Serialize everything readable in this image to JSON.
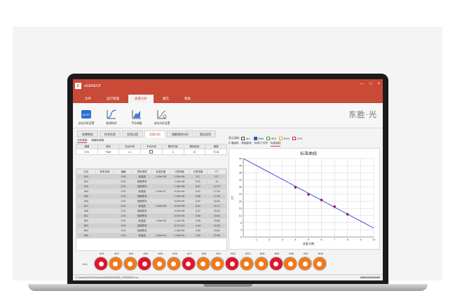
{
  "window": {
    "title": "eGENECP",
    "icon_letter": "E",
    "controls": [
      "—",
      "□",
      "×"
    ]
  },
  "menu": [
    "文件",
    "运行管理",
    "质量分析",
    "报告",
    "帮助"
  ],
  "menu_active_index": 2,
  "ribbon": {
    "buttons": [
      {
        "label": "自动分析设置",
        "icon": "auto-analysis-icon"
      },
      {
        "label": "曲线拟合",
        "icon": "curve-fit-icon"
      },
      {
        "label": "手动调整",
        "icon": "manual-adjust-icon"
      },
      {
        "label": "自动分析设置",
        "icon": "analysis-settings-icon"
      }
    ],
    "brand": "东胜·光"
  },
  "tabs": [
    "结果概览",
    "样本信息",
    "实验过程",
    "定量分析",
    "熔解曲线分析",
    "报告选项"
  ],
  "tabs_active_index": 3,
  "left": {
    "subtabs": [
      "分析参数",
      "阈值线参数"
    ],
    "param_headers": [
      "通道",
      "染料",
      "自动分析",
      "手动分析",
      "基线开始",
      "基线结束",
      "阈值"
    ],
    "param_row": [
      "CH1",
      "FAM",
      "1-1",
      "",
      "3",
      "10",
      "70.06"
    ],
    "sample_headers": [
      "孔位",
      "样本名称",
      "通道",
      "样本类型",
      "标准浓度",
      "计算浓度",
      "计算浓度",
      "CT"
    ],
    "samples": [
      [
        "A01",
        "",
        "CH1",
        "标准品",
        "1.00e+08",
        "1.25e+08",
        "8.1",
        "12.7"
      ],
      [
        "A02",
        "",
        "CH1",
        "待测样本",
        "",
        "1.03e+08",
        "8.01",
        "13"
      ],
      [
        "A03",
        "",
        "CH1",
        "待测样本",
        "",
        "1.18e+08",
        "8.07",
        "12.79"
      ],
      [
        "A04",
        "",
        "CH1",
        "标准品",
        "1.00e+07",
        "8.21e+06",
        "6.91",
        "17.04"
      ],
      [
        "A05",
        "",
        "CH1",
        "待测样本",
        "",
        "7.18e+06",
        "6.86",
        "17.26"
      ],
      [
        "A06",
        "",
        "CH1",
        "待测样本",
        "",
        "8.43e+06",
        "6.97",
        "16.82"
      ],
      [
        "A07",
        "",
        "CH1",
        "标准品",
        "1.00e+06",
        "8.09e+05",
        "5.91",
        "20.74"
      ],
      [
        "A08",
        "",
        "CH1",
        "待测样本",
        "",
        "9.23e+05",
        "5.97",
        "20.53"
      ],
      [
        "B01",
        "",
        "CH1",
        "待测样本",
        "",
        "9.07e+05",
        "5.96",
        "20.56"
      ],
      [
        "B02",
        "",
        "CH1",
        "标准品",
        "1.00e+05",
        "1.14e+05",
        "5.06",
        "23.86"
      ],
      [
        "B03",
        "",
        "CH1",
        "待测样本",
        "",
        "8.77e+04",
        "4.94",
        "24.28"
      ],
      [
        "B04",
        "",
        "CH1",
        "待测样本",
        "",
        "1.16e+05",
        "5.06",
        "23.84"
      ],
      [
        "B05",
        "",
        "CH1",
        "标准品",
        "1.00e+04",
        "1.05e+04",
        "4.02",
        "27.86"
      ]
    ]
  },
  "right": {
    "legend_label": "显示染料:",
    "legend_items": [
      {
        "label": "ALL",
        "color": "#444444",
        "checked": false
      },
      {
        "label": "FAM",
        "color": "#2b5fb8",
        "checked": true
      },
      {
        "label": "HEX",
        "color": "#3aa23a",
        "checked": false
      },
      {
        "label": "ROX",
        "color": "#e8a33a",
        "checked": false
      },
      {
        "label": "CY5",
        "color": "#d02c2c",
        "checked": false
      }
    ],
    "chart_tabs": [
      "扩增曲线",
      "原始曲线",
      "标准CT分布",
      "标准曲线"
    ],
    "chart_tabs_active_index": 3
  },
  "chart_data": {
    "type": "scatter",
    "title": "标准曲线",
    "xlabel": "浓度对数",
    "ylabel": "CT",
    "xlim": [
      0,
      10
    ],
    "ylim": [
      0,
      44
    ],
    "xticks": [
      1,
      2,
      3,
      4,
      5,
      6,
      7,
      8,
      9,
      10
    ],
    "yticks": [
      0,
      4,
      8,
      12,
      16,
      20,
      24,
      28,
      32,
      36,
      40,
      44
    ],
    "grid": true,
    "fit_line": {
      "x": [
        0,
        10
      ],
      "y": [
        44,
        5
      ]
    },
    "points": [
      {
        "x": 4,
        "y": 27.86
      },
      {
        "x": 5,
        "y": 23.86
      },
      {
        "x": 6,
        "y": 20.74
      },
      {
        "x": 7,
        "y": 17.04
      },
      {
        "x": 8,
        "y": 12.7
      }
    ],
    "line_color": "#3a3ae0",
    "point_color": "#8e1d5a"
  },
  "plate": {
    "row_label": "ALL",
    "columns": [
      "A01",
      "A02",
      "A03",
      "A04",
      "A05",
      "A06",
      "A07",
      "A08",
      "B01",
      "B02",
      "B03",
      "B04",
      "B05",
      "B06",
      "B07",
      "B08"
    ],
    "well_colors": [
      "#e0142a",
      "#f07a1a",
      "#f07a1a",
      "#e0142a",
      "#f07a1a",
      "#f07a1a",
      "#e0142a",
      "#f07a1a",
      "#f07a1a",
      "#e0142a",
      "#f07a1a",
      "#f07a1a",
      "#e0142a",
      "#f07a1a",
      "#f07a1a",
      "#f07a1a"
    ]
  },
  "status": {
    "path": "C:\\Users\\SZDS\\Desktop\\NJ8220400089_2020550IK.ew",
    "serial": "85502204000089"
  }
}
